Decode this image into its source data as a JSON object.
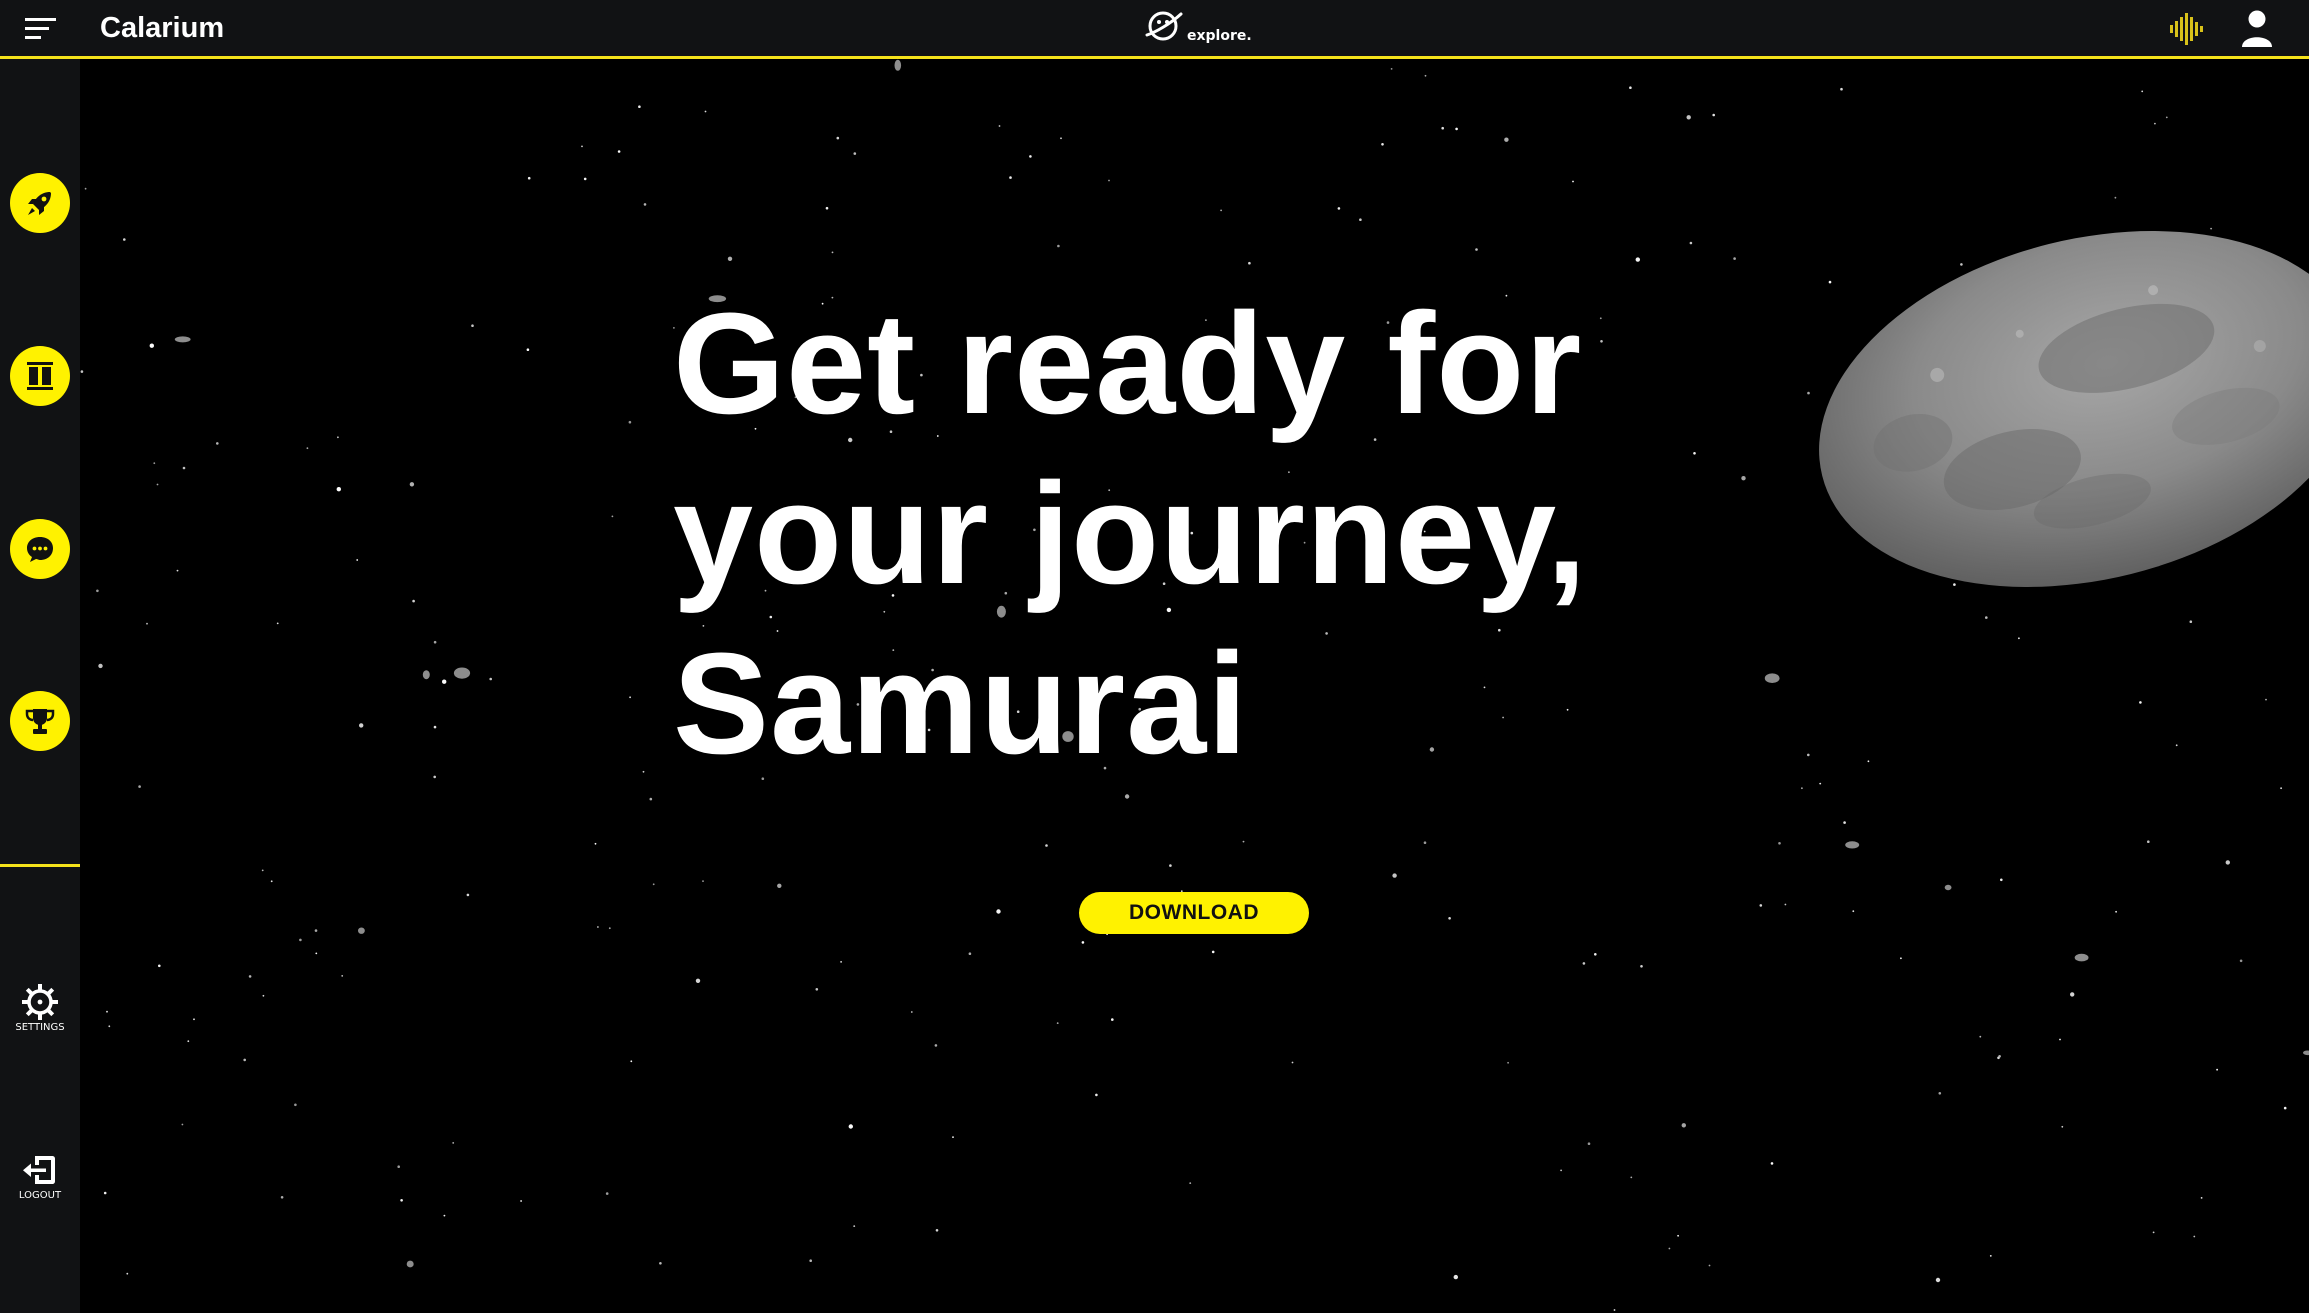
{
  "header": {
    "app_title": "Calarium",
    "brand_text": "explore."
  },
  "hero": {
    "line1": "Get ready for",
    "line2": "your journey,",
    "line3": "Samurai",
    "download_label": "DOWNLOAD"
  },
  "sidebar": {
    "items": [
      {
        "icon": "rocket-icon"
      },
      {
        "icon": "library-icon"
      },
      {
        "icon": "chat-icon"
      },
      {
        "icon": "trophy-icon"
      }
    ],
    "settings_label": "SETTINGS",
    "logout_label": "LOGOUT"
  },
  "colors": {
    "accent": "#fff200",
    "bar_bg": "#111214",
    "space_bg": "#000000"
  }
}
